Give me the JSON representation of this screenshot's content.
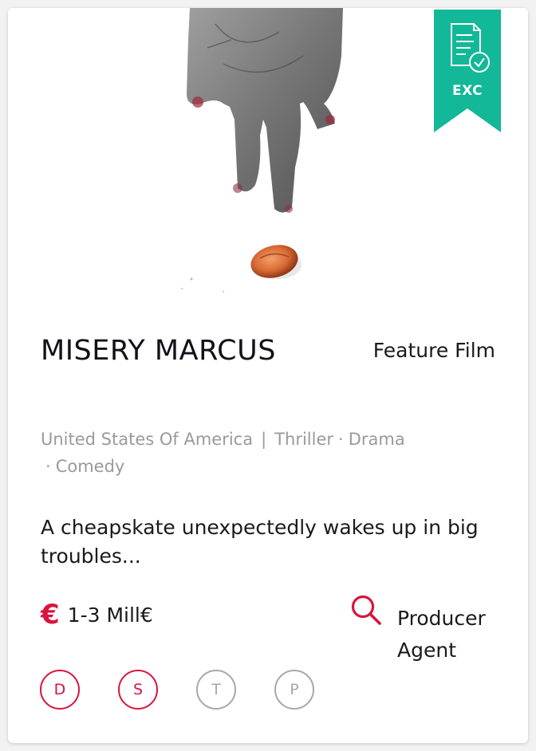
{
  "badge": {
    "label": "EXC",
    "color": "#12b898"
  },
  "project": {
    "title": "MISERY MARCUS",
    "format": "Feature Film",
    "country": "United States Of America",
    "genres": [
      "Thriller",
      "Drama",
      "Comedy"
    ],
    "logline": "A cheapskate unexpectedly wakes up in big troubles...",
    "budget_symbol": "€",
    "budget": "1-3 Mill€",
    "looking_for": [
      "Producer",
      "Agent"
    ]
  },
  "rights": [
    {
      "letter": "D",
      "active": true
    },
    {
      "letter": "S",
      "active": true
    },
    {
      "letter": "T",
      "active": false
    },
    {
      "letter": "P",
      "active": false
    }
  ],
  "colors": {
    "accent": "#d9143e",
    "inactive": "#a8a8a8",
    "muted_text": "#9a9a9a"
  },
  "icons": {
    "poster": "hand-dropping-penny",
    "badge": "document-check-icon",
    "search": "search-icon"
  }
}
